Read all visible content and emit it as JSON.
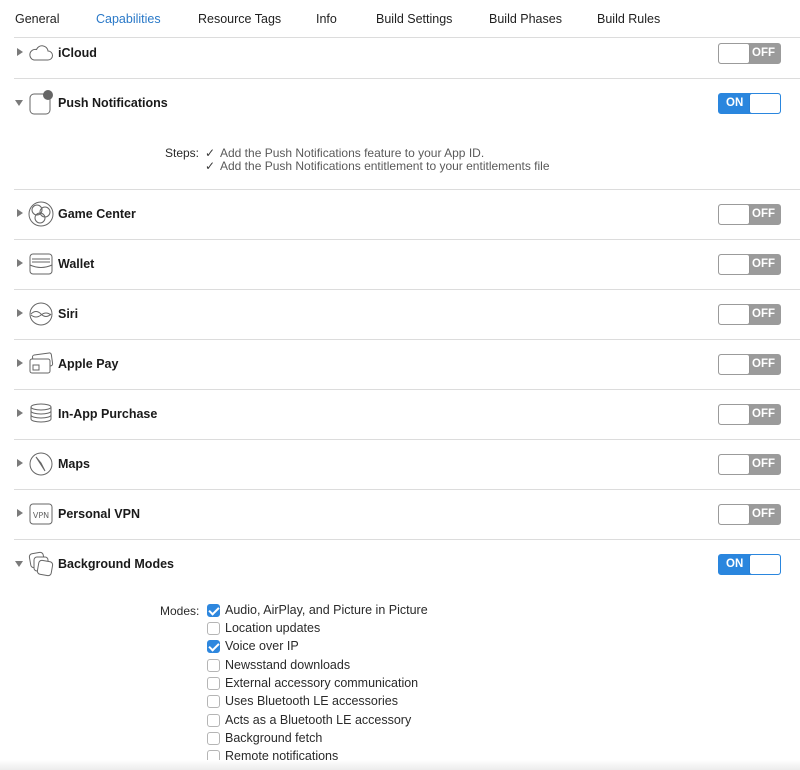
{
  "tabs": [
    {
      "label": "General",
      "active": false
    },
    {
      "label": "Capabilities",
      "active": true
    },
    {
      "label": "Resource Tags",
      "active": false
    },
    {
      "label": "Info",
      "active": false
    },
    {
      "label": "Build Settings",
      "active": false
    },
    {
      "label": "Build Phases",
      "active": false
    },
    {
      "label": "Build Rules",
      "active": false
    }
  ],
  "capabilities": [
    {
      "label": "iCloud",
      "icon": "icloud-icon",
      "state": "OFF",
      "expanded": false
    },
    {
      "label": "Push Notifications",
      "icon": "push-notifications-icon",
      "state": "ON",
      "expanded": true
    },
    {
      "label": "Game Center",
      "icon": "game-center-icon",
      "state": "OFF",
      "expanded": false
    },
    {
      "label": "Wallet",
      "icon": "wallet-icon",
      "state": "OFF",
      "expanded": false
    },
    {
      "label": "Siri",
      "icon": "siri-icon",
      "state": "OFF",
      "expanded": false
    },
    {
      "label": "Apple Pay",
      "icon": "apple-pay-icon",
      "state": "OFF",
      "expanded": false
    },
    {
      "label": "In-App Purchase",
      "icon": "in-app-purchase-icon",
      "state": "OFF",
      "expanded": false
    },
    {
      "label": "Maps",
      "icon": "maps-icon",
      "state": "OFF",
      "expanded": false
    },
    {
      "label": "Personal VPN",
      "icon": "vpn-icon",
      "state": "OFF",
      "expanded": false
    },
    {
      "label": "Background Modes",
      "icon": "background-modes-icon",
      "state": "ON",
      "expanded": true
    }
  ],
  "push_steps": {
    "label": "Steps:",
    "check": "✓",
    "items": [
      "Add the Push Notifications feature to your App ID.",
      "Add the Push Notifications entitlement to your entitlements file"
    ]
  },
  "background_modes": {
    "label": "Modes:",
    "items": [
      {
        "label": "Audio, AirPlay, and Picture in Picture",
        "checked": true
      },
      {
        "label": "Location updates",
        "checked": false
      },
      {
        "label": "Voice over IP",
        "checked": true
      },
      {
        "label": "Newsstand downloads",
        "checked": false
      },
      {
        "label": "External accessory communication",
        "checked": false
      },
      {
        "label": "Uses Bluetooth LE accessories",
        "checked": false
      },
      {
        "label": "Acts as a Bluetooth LE accessory",
        "checked": false
      },
      {
        "label": "Background fetch",
        "checked": false
      },
      {
        "label": "Remote notifications",
        "checked": false
      }
    ]
  },
  "colors": {
    "accent": "#2a79c8",
    "toggle_on": "#2a86de",
    "toggle_off": "#9b9b9b",
    "checkbox_checked": "#2e87de"
  }
}
